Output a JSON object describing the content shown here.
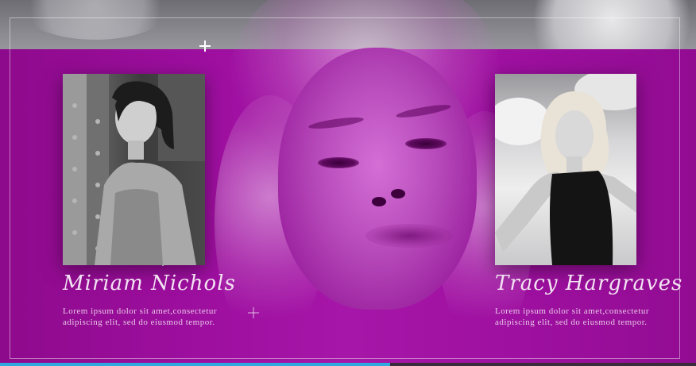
{
  "profiles": [
    {
      "name": "Miriam Nichols",
      "description_line1": "Lorem ipsum dolor sit amet,consectetur",
      "description_line2": "adipiscing elit, sed do eiusmod tempor."
    },
    {
      "name": "Tracy Hargraves",
      "description_line1": "Lorem ipsum dolor sit amet,consectetur",
      "description_line2": "adipiscing elit, sed do eiusmod tempor."
    }
  ],
  "colors": {
    "overlay": "#a616a8",
    "text": "#f3e2f3",
    "progress": "#2fa8e0"
  },
  "playback": {
    "progress_fraction": 0.56
  }
}
